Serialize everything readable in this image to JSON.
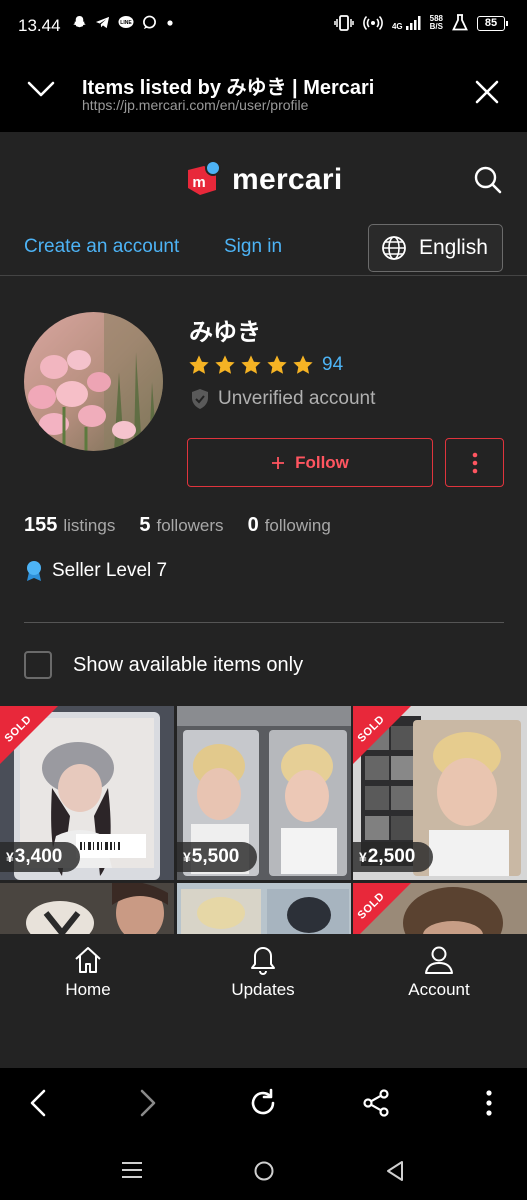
{
  "status_bar": {
    "time": "13.44",
    "network_type": "4G",
    "data_speed_value": "588",
    "data_speed_unit": "B/S",
    "battery": "85"
  },
  "browser_tab": {
    "title": "Items listed by みゆき | Mercari",
    "url": "https://jp.mercari.com/en/user/profile"
  },
  "header": {
    "logo_text": "mercari",
    "logo_badge_letter": "m",
    "create_account": "Create an account",
    "sign_in": "Sign in",
    "language": "English"
  },
  "profile": {
    "name": "みゆき",
    "rating_stars": 5,
    "rating_count": "94",
    "verification": "Unverified account",
    "follow_label": "Follow",
    "stats": [
      {
        "value": "155",
        "label": "listings"
      },
      {
        "value": "5",
        "label": "followers"
      },
      {
        "value": "0",
        "label": "following"
      }
    ],
    "seller_level": "Seller Level 7"
  },
  "filter": {
    "available_only_label": "Show available items only"
  },
  "items": [
    {
      "price": "3,400",
      "sold": true
    },
    {
      "price": "5,500",
      "sold": false
    },
    {
      "price": "2,500",
      "sold": true
    },
    {
      "price": "",
      "sold": false
    },
    {
      "price": "",
      "sold": false
    },
    {
      "price": "",
      "sold": true
    }
  ],
  "labels": {
    "sold": "SOLD",
    "currency": "¥"
  },
  "bottom_nav": {
    "home": "Home",
    "updates": "Updates",
    "account": "Account"
  },
  "colors": {
    "accent_blue": "#4db3f5",
    "mercari_red": "#e8283a",
    "star": "#f5b324",
    "page_bg": "#232323"
  }
}
